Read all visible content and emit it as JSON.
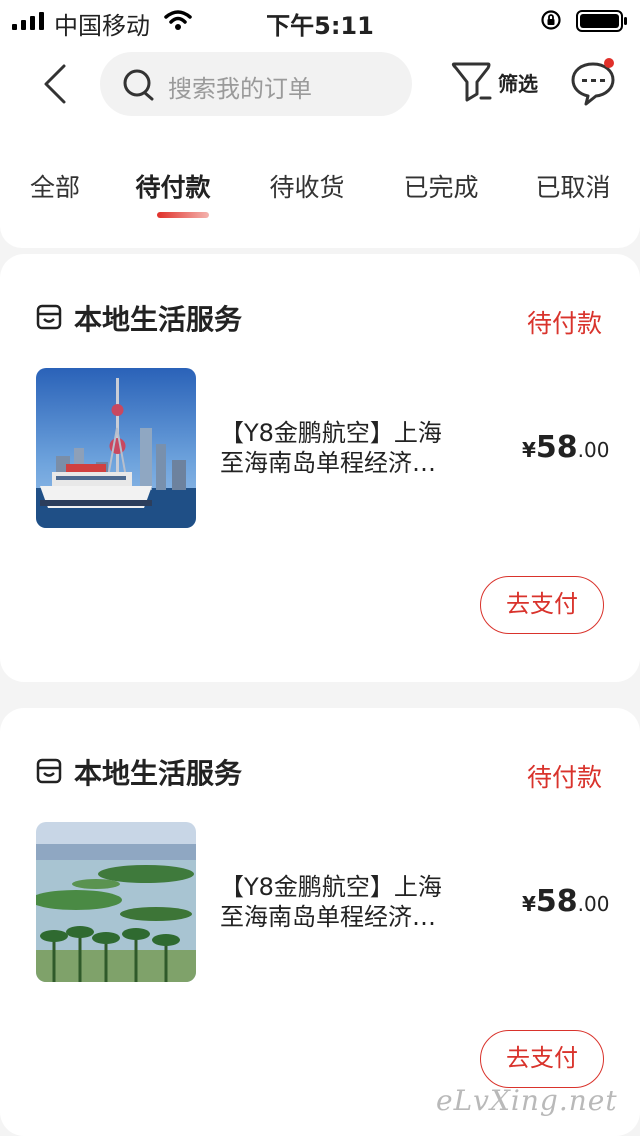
{
  "status_bar": {
    "carrier": "中国移动",
    "time": "下午5:11"
  },
  "header": {
    "search_placeholder": "搜索我的订单",
    "filter_label": "筛选",
    "icons": {
      "back": "chevron-left-icon",
      "search": "search-icon",
      "filter": "filter-icon",
      "messages": "chat-bubble-icon"
    },
    "has_unread_messages": true
  },
  "tabs": [
    {
      "label": "全部",
      "active": false
    },
    {
      "label": "待付款",
      "active": true
    },
    {
      "label": "待收货",
      "active": false
    },
    {
      "label": "已完成",
      "active": false
    },
    {
      "label": "已取消",
      "active": false
    }
  ],
  "orders": [
    {
      "shop_name": "本地生活服务",
      "status": "待付款",
      "product_title_line1": "【Y8金鹏航空】上海",
      "product_title_line2": "至海南岛单程经济…",
      "price_currency": "¥",
      "price_integer": "58",
      "price_decimal": ".00",
      "action_label": "去支付",
      "thumbnail": "shanghai-skyline-photo"
    },
    {
      "shop_name": "本地生活服务",
      "status": "待付款",
      "product_title_line1": "【Y8金鹏航空】上海",
      "product_title_line2": "至海南岛单程经济…",
      "price_currency": "¥",
      "price_integer": "58",
      "price_decimal": ".00",
      "action_label": "去支付",
      "thumbnail": "lake-palm-trees-photo"
    }
  ],
  "watermark": "eLvXing.net",
  "colors": {
    "accent": "#d9332c",
    "background": "#f4f4f4"
  }
}
